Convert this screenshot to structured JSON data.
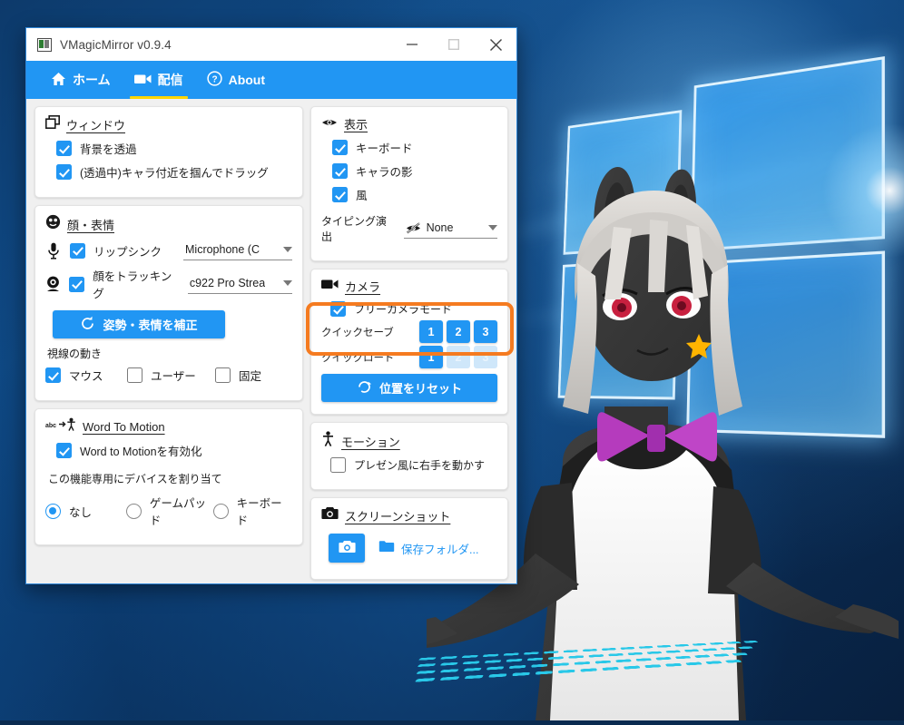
{
  "window": {
    "title": "VMagicMirror v0.9.4",
    "icon": "app-icon",
    "minimize": "—",
    "maximize": "□",
    "close": "✕"
  },
  "tabs": [
    {
      "label": "ホーム",
      "icon": "home-icon",
      "active": false
    },
    {
      "label": "配信",
      "icon": "video-camera-icon",
      "active": true
    },
    {
      "label": "About",
      "icon": "question-circle-icon",
      "active": false
    }
  ],
  "cards": {
    "window_card": {
      "title": "ウィンドウ",
      "icon": "window-icon",
      "checkboxes": [
        {
          "label": "背景を透過",
          "checked": true
        },
        {
          "label": "(透過中)キャラ付近を掴んでドラッグ",
          "checked": true
        }
      ]
    },
    "face_card": {
      "title": "顔・表情",
      "icon": "face-icon",
      "lipsync": {
        "label": "リップシンク",
        "checked": true,
        "icon": "microphone-icon",
        "device": "Microphone (C"
      },
      "facetrack": {
        "label": "顔をトラッキング",
        "checked": true,
        "icon": "webcam-icon",
        "device": "c922 Pro Strea"
      },
      "calibrate_button": {
        "label": "姿勢・表情を補正",
        "icon": "refresh-icon"
      },
      "gaze_label": "視線の動き",
      "gaze_options": [
        {
          "label": "マウス",
          "checked": true
        },
        {
          "label": "ユーザー",
          "checked": false
        },
        {
          "label": "固定",
          "checked": false
        }
      ]
    },
    "word_to_motion_card": {
      "title": "Word To Motion",
      "icon": "word-to-motion-icon",
      "enable": {
        "label": "Word to Motionを有効化",
        "checked": true
      },
      "device_label": "この機能専用にデバイスを割り当て",
      "device_options": [
        {
          "label": "なし",
          "selected": true
        },
        {
          "label": "ゲームパッド",
          "selected": false
        },
        {
          "label": "キーボード",
          "selected": false
        }
      ]
    },
    "display_card": {
      "title": "表示",
      "icon": "eye-icon",
      "checkboxes": [
        {
          "label": "キーボード",
          "checked": true
        },
        {
          "label": "キャラの影",
          "checked": true
        },
        {
          "label": "風",
          "checked": true
        }
      ],
      "typing_effect": {
        "label": "タイピング演出",
        "icon": "eye-off-icon",
        "value": "None"
      }
    },
    "camera_card": {
      "title": "カメラ",
      "icon": "video-camera-icon",
      "free_camera": {
        "label": "フリーカメラモード",
        "checked": true
      },
      "quick_save": {
        "label": "クイックセーブ",
        "slots": [
          {
            "label": "1",
            "enabled": true
          },
          {
            "label": "2",
            "enabled": true
          },
          {
            "label": "3",
            "enabled": true
          }
        ]
      },
      "quick_load": {
        "label": "クイックロード",
        "slots": [
          {
            "label": "1",
            "enabled": true
          },
          {
            "label": "2",
            "enabled": false
          },
          {
            "label": "3",
            "enabled": false
          }
        ]
      },
      "reset_button": {
        "label": "位置をリセット",
        "icon": "refresh-icon"
      },
      "highlight_color": "#f57b20"
    },
    "motion_card": {
      "title": "モーション",
      "icon": "person-icon",
      "checkboxes": [
        {
          "label": "プレゼン風に右手を動かす",
          "checked": false
        }
      ]
    },
    "screenshot_card": {
      "title": "スクリーンショット",
      "icon": "camera-icon",
      "shoot_button": {
        "icon": "camera-icon"
      },
      "folder_link": {
        "label": "保存フォルダ...",
        "icon": "folder-icon"
      }
    }
  },
  "colors": {
    "accent": "#2196f3",
    "tab_underline": "#ffd600",
    "highlight": "#f57b20",
    "app_bg": "#f0f0f0"
  },
  "desktop": {
    "wallpaper": "windows-10-logo-wallpaper",
    "avatar": "vrm-avatar-character",
    "keyboard": "virtual-keyboard-cyan"
  }
}
